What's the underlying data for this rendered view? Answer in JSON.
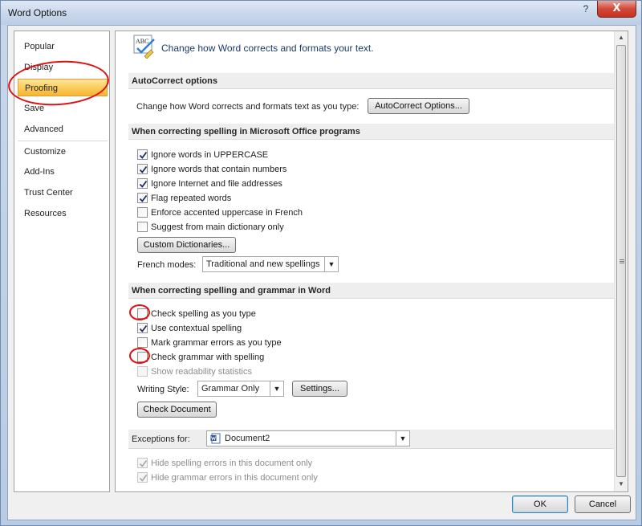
{
  "window": {
    "title": "Word Options",
    "help_glyph": "?",
    "close_glyph": "X"
  },
  "nav": {
    "items": [
      {
        "label": "Popular"
      },
      {
        "label": "Display"
      },
      {
        "label": "Proofing",
        "selected": true
      },
      {
        "label": "Save"
      },
      {
        "label": "Advanced"
      },
      {
        "label": "Customize"
      },
      {
        "label": "Add-Ins"
      },
      {
        "label": "Trust Center"
      },
      {
        "label": "Resources"
      }
    ]
  },
  "header": {
    "icon": "abc-proofing-icon",
    "icon_text": "ABC",
    "text": "Change how Word corrects and formats your text."
  },
  "autocorrect": {
    "section_title": "AutoCorrect options",
    "description": "Change how Word corrects and formats text as you type:",
    "button": "AutoCorrect Options..."
  },
  "office_spelling": {
    "section_title": "When correcting spelling in Microsoft Office programs",
    "options": [
      {
        "label": "Ignore words in UPPERCASE",
        "checked": true
      },
      {
        "label": "Ignore words that contain numbers",
        "checked": true
      },
      {
        "label": "Ignore Internet and file addresses",
        "checked": true
      },
      {
        "label": "Flag repeated words",
        "checked": true
      },
      {
        "label": "Enforce accented uppercase in French",
        "checked": false
      },
      {
        "label": "Suggest from main dictionary only",
        "checked": false
      }
    ],
    "custom_dictionaries_button": "Custom Dictionaries...",
    "french_modes_label": "French modes:",
    "french_modes_value": "Traditional and new spellings"
  },
  "word_spelling": {
    "section_title": "When correcting spelling and grammar in Word",
    "options": [
      {
        "label": "Check spelling as you type",
        "checked": false
      },
      {
        "label": "Use contextual spelling",
        "checked": true
      },
      {
        "label": "Mark grammar errors as you type",
        "checked": false
      },
      {
        "label": "Check grammar with spelling",
        "checked": false
      },
      {
        "label": "Show readability statistics",
        "checked": false,
        "disabled": true
      }
    ],
    "writing_style_label": "Writing Style:",
    "writing_style_value": "Grammar Only",
    "settings_button": "Settings...",
    "check_document_button": "Check Document"
  },
  "exceptions": {
    "label": "Exceptions for:",
    "document": "Document2",
    "options": [
      {
        "label": "Hide spelling errors in this document only",
        "checked": true,
        "disabled": true
      },
      {
        "label": "Hide grammar errors in this document only",
        "checked": true,
        "disabled": true
      }
    ]
  },
  "footer": {
    "ok": "OK",
    "cancel": "Cancel"
  },
  "annotation_color": "#e01010",
  "selection_color": "#fbcd5c"
}
